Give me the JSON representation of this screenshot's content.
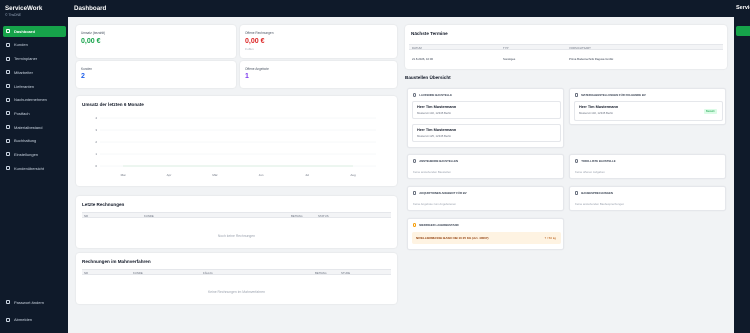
{
  "app": {
    "name": "ServiceWork",
    "version": "© ThsDNE"
  },
  "sidebar": {
    "items": [
      {
        "label": "Dashboard",
        "icon": "dashboard-icon",
        "active": true
      },
      {
        "label": "Kunden",
        "icon": "users-icon"
      },
      {
        "label": "Terminplaner",
        "icon": "calendar-icon"
      },
      {
        "label": "Mitarbeiter",
        "icon": "team-icon"
      },
      {
        "label": "Lieferanten",
        "icon": "truck-icon"
      },
      {
        "label": "Nachunternehmen",
        "icon": "briefcase-icon"
      },
      {
        "label": "Postfach",
        "icon": "mail-icon"
      },
      {
        "label": "Materialbestand",
        "icon": "box-icon"
      },
      {
        "label": "Buchhaltung",
        "icon": "ledger-icon"
      },
      {
        "label": "Einstellungen",
        "icon": "gear-icon"
      },
      {
        "label": "Kundenübersicht",
        "icon": "list-icon"
      }
    ],
    "bottom": [
      {
        "label": "Passwort ändern",
        "icon": "key-icon"
      },
      {
        "label": "Abmelden",
        "icon": "logout-icon"
      }
    ]
  },
  "header": {
    "title": "Dashboard"
  },
  "stats": [
    {
      "label": "Umsatz (bezahlt)",
      "value": "0,00 €",
      "sub": "",
      "color": "#16a34a"
    },
    {
      "label": "Offene Rechnungen",
      "value": "0,00 €",
      "sub": "0 offen",
      "color": "#dc2626"
    },
    {
      "label": "Kunden",
      "value": "2",
      "sub": "",
      "color": "#2563eb"
    },
    {
      "label": "Offene Angebote",
      "value": "1",
      "sub": "",
      "color": "#7c3aed"
    }
  ],
  "chart_data": {
    "type": "line",
    "title": "Umsatz der letzten 6 Monate",
    "categories": [
      "Mai",
      "Apr",
      "Mär",
      "Jun",
      "Jul",
      "Aug"
    ],
    "series": [
      {
        "values": [
          0,
          0,
          0,
          0,
          0,
          0
        ]
      }
    ],
    "ylim": [
      0,
      4
    ],
    "yticks": [
      "4",
      "3",
      "2",
      "1",
      "0"
    ],
    "grid": true
  },
  "invoices": {
    "title": "Letzte Rechnungen",
    "columns": [
      "NR",
      "KUNDE",
      "BETRAG",
      "STATUS"
    ],
    "empty": "Noch keine Rechnungen"
  },
  "dunning": {
    "title": "Rechnungen im Mahnverfahren",
    "columns": [
      "NR",
      "KUNDE",
      "FÄLLIG",
      "BETRAG",
      "STUFE"
    ],
    "empty": "Keine Rechnungen im Mahnverfahren"
  },
  "appointments": {
    "title": "Nächste Termine",
    "columns": [
      "DATUM",
      "TYP",
      "VORSICHTSART"
    ],
    "rows": [
      {
        "date": "21.8.2026, 10:00",
        "type": "Sonstiges",
        "desc": "Prima Bodentechnik Ragusa GmbH"
      }
    ]
  },
  "construction": {
    "title": "Baustellen Übersicht",
    "running": {
      "title": "LAUFENDE BAUSTELLE",
      "entries": [
        {
          "name": "Herr Tim Mustermann",
          "address": "Musterstr.132, 12345 Berlin"
        },
        {
          "name": "Herr Tim Mustermann",
          "address": "Musterstr.125, 12345 Berlin"
        }
      ]
    },
    "materials": {
      "title": "MATERIALBESTELLUNGEN FÜR FOLGENDE BV",
      "entries": [
        {
          "name": "Herr Tim Mustermann",
          "address": "Musterstr.132, 12345 Berlin",
          "badge": "Bestellt"
        }
      ]
    },
    "pending": {
      "title": "ANSTEHENDE BAUSTELLEN",
      "text": "Keine anstehenden Baustellen"
    },
    "todo": {
      "title": "TODO-LISTE BAUSTELLE",
      "text": "Keine offenen Aufgaben"
    },
    "offer": {
      "title": "AKQUIRTIONEN ANGEBOT FÜR BV",
      "text": "Keine Angebote zum Angebotenen"
    },
    "delivery": {
      "title": "BAUBESPRECHUNGEN",
      "text": "Keine anstehenden Baubesprechungen"
    },
    "stock": {
      "title": "NIEDRIGER LAGERBESTAND",
      "item": "NIVELLIERMASSE BASIC NB 10 25 KG (Art. 40007)",
      "qty": "7 / 50 kg"
    }
  }
}
